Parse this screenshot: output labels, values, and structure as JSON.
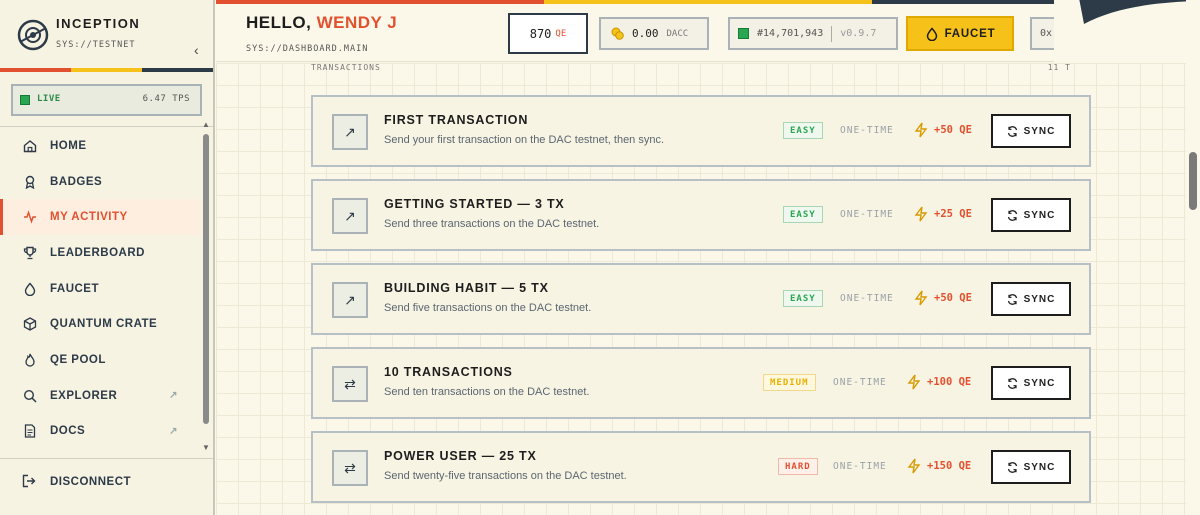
{
  "brand": {
    "name": "INCEPTION",
    "network": "SYS://TESTNET",
    "collapse_glyph": "‹"
  },
  "colors": {
    "accent": "#e2512f",
    "yellow": "#f6c21a",
    "green": "#2aa652",
    "navy": "#2d3a48",
    "stripe": [
      "#e2512f",
      "#f6c21a",
      "#2d3a48"
    ]
  },
  "status": {
    "live_label": "LIVE",
    "tps": "6.47 TPS"
  },
  "sidebar": {
    "items": [
      {
        "label": "HOME",
        "icon": "home-icon",
        "active": false,
        "external": false
      },
      {
        "label": "BADGES",
        "icon": "badge-icon",
        "active": false,
        "external": false
      },
      {
        "label": "MY ACTIVITY",
        "icon": "activity-icon",
        "active": true,
        "external": false
      },
      {
        "label": "LEADERBOARD",
        "icon": "trophy-icon",
        "active": false,
        "external": false
      },
      {
        "label": "FAUCET",
        "icon": "droplet-icon",
        "active": false,
        "external": false
      },
      {
        "label": "QUANTUM CRATE",
        "icon": "cube-icon",
        "active": false,
        "external": false
      },
      {
        "label": "QE POOL",
        "icon": "flame-icon",
        "active": false,
        "external": false
      },
      {
        "label": "EXPLORER",
        "icon": "search-icon",
        "active": false,
        "external": true
      },
      {
        "label": "DOCS",
        "icon": "document-icon",
        "active": false,
        "external": true
      }
    ],
    "external_glyph": "↗",
    "disconnect_label": "DISCONNECT"
  },
  "header": {
    "greeting": "HELLO,",
    "user_name": "WENDY J",
    "route": "SYS://DASHBOARD.MAIN",
    "qe_balance": "870",
    "qe_unit": "QE",
    "dacc_balance": "0.00",
    "dacc_unit": "DACC",
    "block_number": "#14,701,943",
    "version": "v0.9.7",
    "faucet_label": "FAUCET",
    "address_prefix": "0x"
  },
  "transactions": {
    "section_label": "TRANSACTIONS",
    "count_label": "11 T",
    "sync_label": "SYNC",
    "tasks": [
      {
        "title": "FIRST TRANSACTION",
        "description": "Send your first transaction on the DAC testnet, then sync.",
        "difficulty": "EASY",
        "frequency": "ONE-TIME",
        "reward": "+50 QE",
        "icon": "arrow-up-right-icon",
        "glyph": "↗"
      },
      {
        "title": "GETTING STARTED — 3 TX",
        "description": "Send three transactions on the DAC testnet.",
        "difficulty": "EASY",
        "frequency": "ONE-TIME",
        "reward": "+25 QE",
        "icon": "arrow-up-right-icon",
        "glyph": "↗"
      },
      {
        "title": "BUILDING HABIT — 5 TX",
        "description": "Send five transactions on the DAC testnet.",
        "difficulty": "EASY",
        "frequency": "ONE-TIME",
        "reward": "+50 QE",
        "icon": "arrow-up-right-icon",
        "glyph": "↗"
      },
      {
        "title": "10 TRANSACTIONS",
        "description": "Send ten transactions on the DAC testnet.",
        "difficulty": "MEDIUM",
        "frequency": "ONE-TIME",
        "reward": "+100 QE",
        "icon": "swap-arrows-icon",
        "glyph": "⇄"
      },
      {
        "title": "POWER USER — 25 TX",
        "description": "Send twenty-five transactions on the DAC testnet.",
        "difficulty": "HARD",
        "frequency": "ONE-TIME",
        "reward": "+150 QE",
        "icon": "swap-arrows-icon",
        "glyph": "⇄"
      }
    ]
  }
}
